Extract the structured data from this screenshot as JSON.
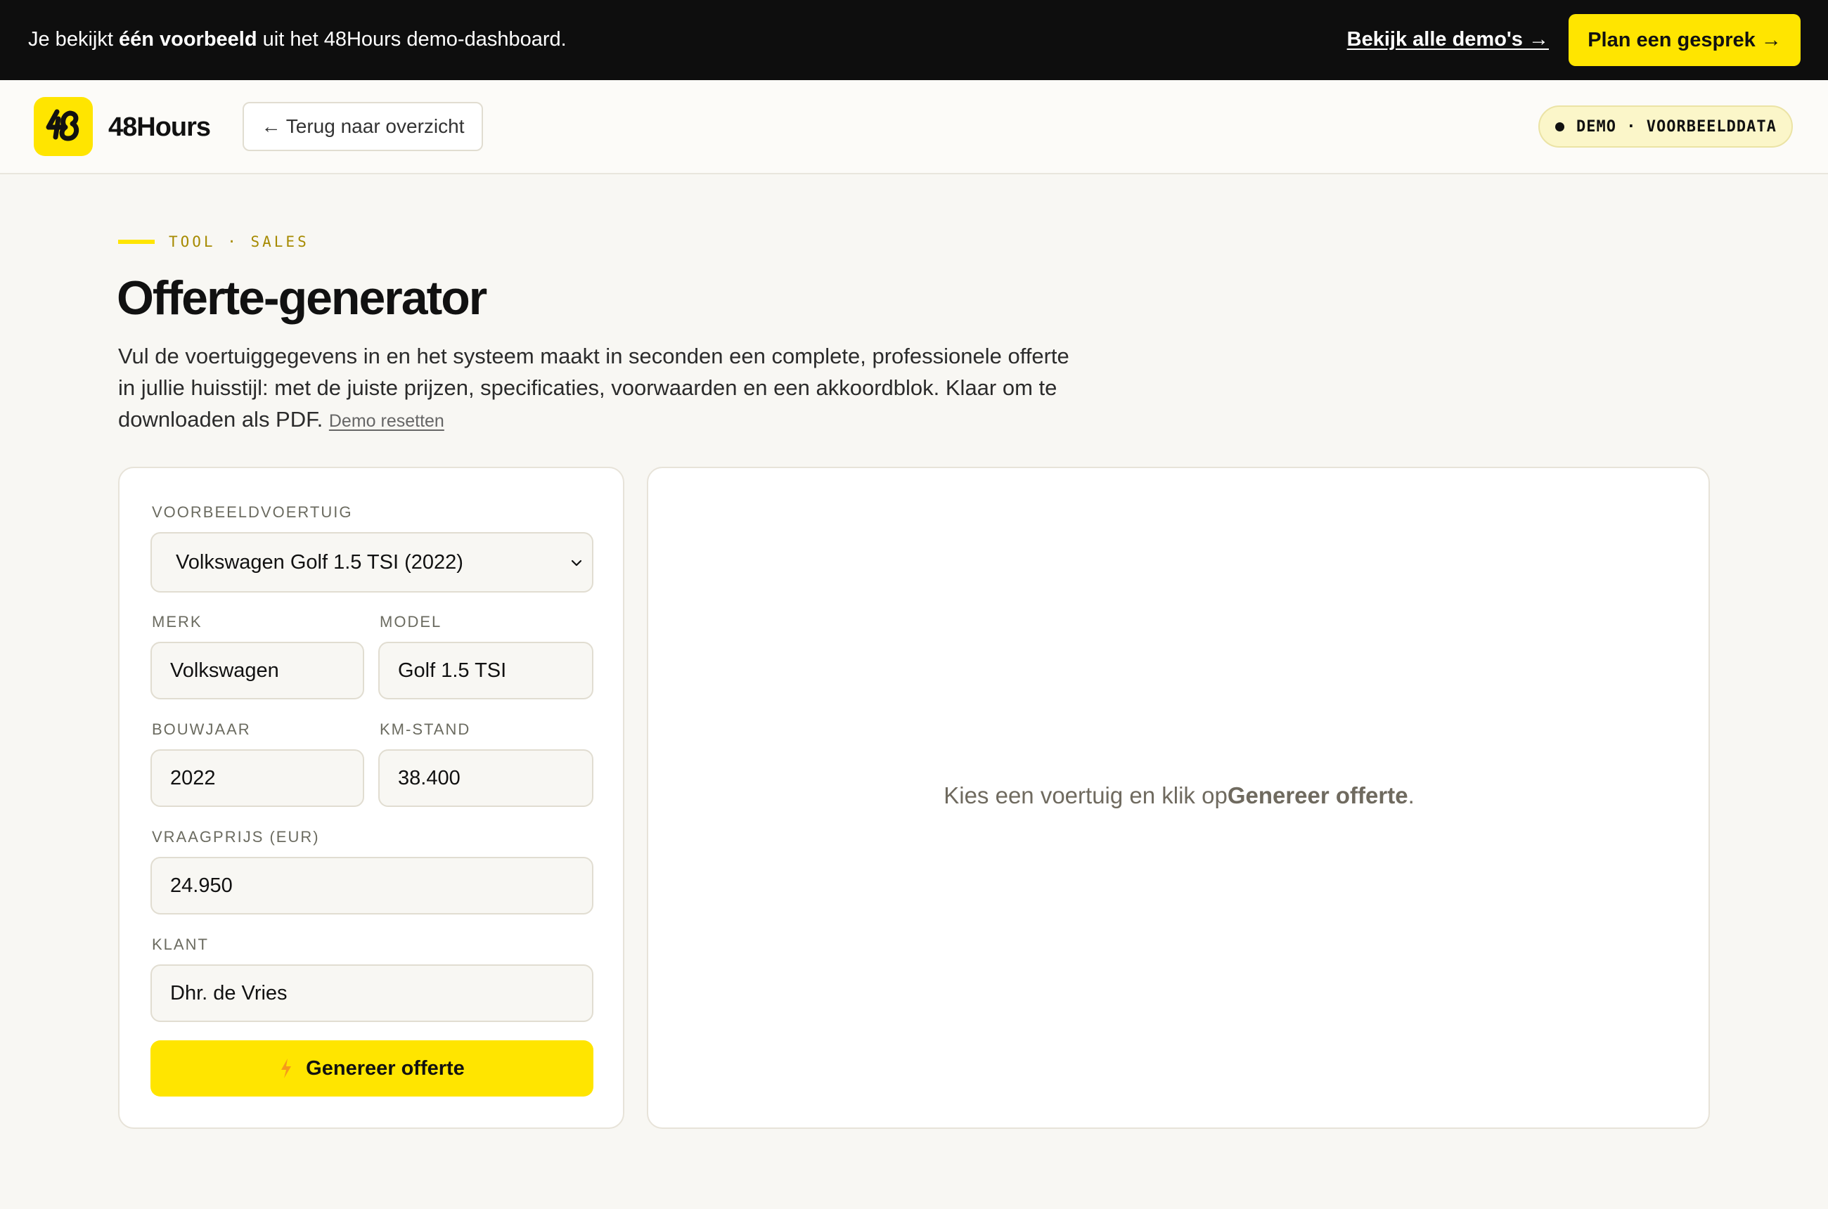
{
  "banner": {
    "text_prefix": "Je bekijkt ",
    "text_bold": "één voorbeeld",
    "text_suffix": " uit het 48Hours demo-dashboard.",
    "all_demos_link": "Bekijk alle demo's →",
    "cta_label": "Plan een gesprek →"
  },
  "header": {
    "brand": "48Hours",
    "logo_icon": "48-logo-icon",
    "back_label": "← Terug naar overzicht",
    "demo_badge": "DEMO · VOORBEELDDATA"
  },
  "intro": {
    "eyebrow": "TOOL · SALES",
    "title": "Offerte-generator",
    "description": "Vul de voertuiggegevens in en het systeem maakt in seconden een complete, professionele offerte in jullie huisstijl: met de juiste prijzen, specificaties, voorwaarden en een akkoordblok. Klaar om te downloaden als PDF.",
    "reset_link": "Demo resetten"
  },
  "form": {
    "vehicle_label": "VOORBEELDVOERTUIG",
    "vehicle_value": "Volkswagen Golf 1.5 TSI (2022)",
    "brand_label": "MERK",
    "brand_value": "Volkswagen",
    "model_label": "MODEL",
    "model_value": "Golf 1.5 TSI",
    "year_label": "BOUWJAAR",
    "year_value": "2022",
    "mileage_label": "KM-STAND",
    "mileage_value": "38.400",
    "price_label": "VRAAGPRIJS (EUR)",
    "price_value": "24.950",
    "client_label": "KLANT",
    "client_value": "Dhr. de Vries",
    "generate_label": "Genereer offerte",
    "generate_icon": "lightning-bolt-icon"
  },
  "preview": {
    "empty_prefix": "Kies een voertuig en klik op",
    "empty_bold": "Genereer offerte",
    "empty_suffix": "."
  },
  "colors": {
    "accent": "#ffe500",
    "banner_bg": "#0e0e0e",
    "page_bg": "#f8f7f3",
    "eyebrow": "#a68a00"
  }
}
